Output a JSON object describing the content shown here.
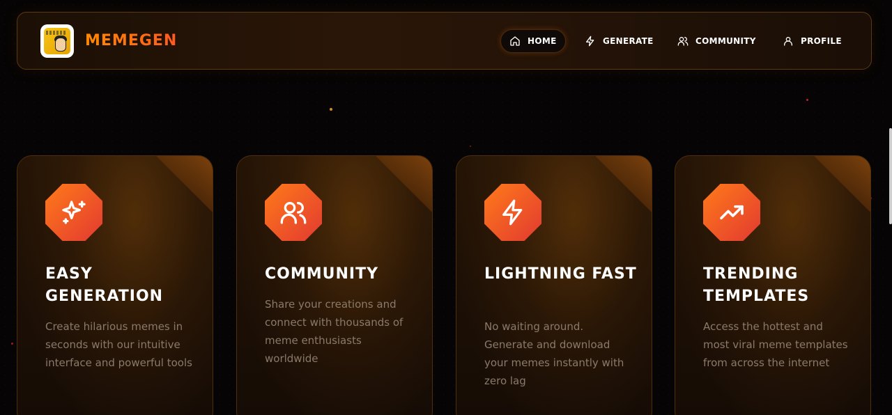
{
  "app": {
    "brand": "MEMEGEN"
  },
  "nav": {
    "items": [
      {
        "label": "HOME",
        "icon": "home-icon"
      },
      {
        "label": "GENERATE",
        "icon": "lightning-icon"
      },
      {
        "label": "COMMUNITY",
        "icon": "users-icon"
      },
      {
        "label": "PROFILE",
        "icon": "user-icon"
      }
    ]
  },
  "features": [
    {
      "title": "EASY GENERATION",
      "description": "Create hilarious memes in seconds with our intuitive interface and powerful tools",
      "icon": "sparkles-icon"
    },
    {
      "title": "COMMUNITY",
      "description": "Share your creations and connect with thousands of meme enthusiasts worldwide",
      "icon": "users-icon"
    },
    {
      "title": "LIGHTNING FAST",
      "description": "No waiting around. Generate and download your memes instantly with zero lag",
      "icon": "lightning-icon"
    },
    {
      "title": "TRENDING TEMPLATES",
      "description": "Access the hottest and most viral meme templates from across the internet",
      "icon": "trending-up-icon"
    }
  ],
  "colors": {
    "accent_orange": "#ff8a00",
    "accent_red": "#e23a30",
    "background": "#060404",
    "card_border": "#4e2e0c",
    "description_text": "#8a7a6a"
  }
}
